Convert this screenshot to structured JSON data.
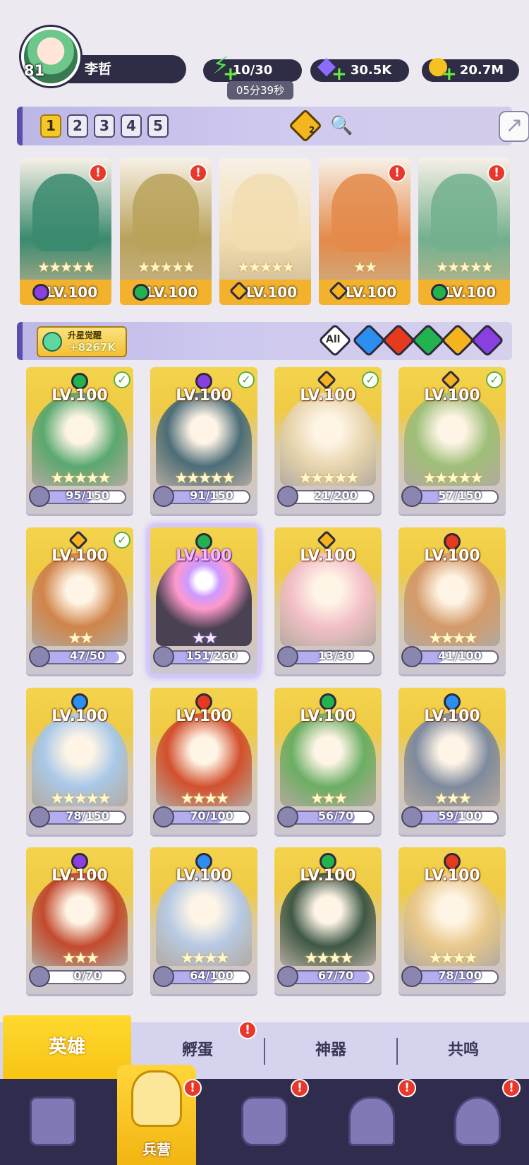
{
  "profile": {
    "level": "81",
    "name": "李哲"
  },
  "resources": {
    "energy": "10/30",
    "energy_timer": "05分39秒",
    "gems": "30.5K",
    "gold": "20.7M"
  },
  "team": {
    "tabs": [
      "1",
      "2",
      "3",
      "4",
      "5"
    ],
    "active_tab": "1",
    "badge_count": "2",
    "members": [
      {
        "element": "dark",
        "level": "LV.100",
        "stars": 5,
        "alert": true,
        "color": "#3a8a6e"
      },
      {
        "element": "wind",
        "level": "LV.100",
        "stars": 5,
        "alert": true,
        "color": "#b9a25a"
      },
      {
        "element": "light",
        "level": "LV.100",
        "stars": 5,
        "alert": false,
        "color": "#f2ddb0"
      },
      {
        "element": "light",
        "level": "LV.100",
        "stars": 2,
        "alert": true,
        "color": "#e48a4a"
      },
      {
        "element": "wind",
        "level": "LV.100",
        "stars": 5,
        "alert": true,
        "color": "#72b08d"
      }
    ]
  },
  "filter": {
    "awaken_label": "升星觉醒",
    "awaken_value": "+8267K",
    "all_label": "All",
    "elements": [
      "water",
      "fire",
      "wind",
      "light",
      "dark"
    ]
  },
  "heroes": [
    {
      "element": "wind",
      "level": "LV.100",
      "stars": 5,
      "check": true,
      "shards": "95/150",
      "progress": 0.63,
      "color": "#5aa870"
    },
    {
      "element": "dark",
      "level": "LV.100",
      "stars": 5,
      "check": true,
      "shards": "91/150",
      "progress": 0.61,
      "color": "#4c6d78"
    },
    {
      "element": "light",
      "level": "LV.100",
      "stars": 5,
      "check": true,
      "shards": "21/200",
      "progress": 0.11,
      "color": "#e8d6b0"
    },
    {
      "element": "light",
      "level": "LV.100",
      "stars": 5,
      "check": true,
      "shards": "57/150",
      "progress": 0.38,
      "color": "#9fbf79"
    },
    {
      "element": "light",
      "level": "LV.100",
      "stars": 2,
      "check": true,
      "shards": "47/50",
      "progress": 0.94,
      "color": "#d0844a"
    },
    {
      "element": "wind",
      "level": "LV.100",
      "stars": 2,
      "check": false,
      "shards": "151/260",
      "progress": 0.58,
      "color": "#4a4252",
      "selected": true,
      "rainbow": true
    },
    {
      "element": "light",
      "level": "LV.100",
      "stars": 0,
      "check": false,
      "shards": "13/30",
      "progress": 0.43,
      "color": "#f3c0c8"
    },
    {
      "element": "fire",
      "level": "LV.100",
      "stars": 4,
      "check": false,
      "shards": "41/100",
      "progress": 0.41,
      "color": "#d49a6a"
    },
    {
      "element": "water",
      "level": "LV.100",
      "stars": 5,
      "check": false,
      "shards": "78/150",
      "progress": 0.52,
      "color": "#a9c8e8"
    },
    {
      "element": "fire",
      "level": "LV.100",
      "stars": 4,
      "check": false,
      "shards": "70/100",
      "progress": 0.7,
      "color": "#d2502e"
    },
    {
      "element": "wind",
      "level": "LV.100",
      "stars": 3,
      "check": false,
      "shards": "56/70",
      "progress": 0.8,
      "color": "#6bae64"
    },
    {
      "element": "water",
      "level": "LV.100",
      "stars": 3,
      "check": false,
      "shards": "59/100",
      "progress": 0.59,
      "color": "#7f8a9e"
    },
    {
      "element": "dark",
      "level": "LV.100",
      "stars": 3,
      "check": false,
      "shards": "0/70",
      "progress": 0.0,
      "color": "#c24a2e"
    },
    {
      "element": "water",
      "level": "LV.100",
      "stars": 4,
      "check": false,
      "shards": "64/100",
      "progress": 0.64,
      "color": "#b7c9e4"
    },
    {
      "element": "wind",
      "level": "LV.100",
      "stars": 4,
      "check": false,
      "shards": "67/70",
      "progress": 0.96,
      "color": "#3f5846"
    },
    {
      "element": "fire",
      "level": "LV.100",
      "stars": 4,
      "check": false,
      "shards": "78/100",
      "progress": 0.78,
      "color": "#e9c98c"
    }
  ],
  "subtabs": {
    "heroes": "英雄",
    "hatch": "孵蛋",
    "artifact": "神器",
    "resonance": "共鸣"
  },
  "bottom_nav": {
    "active_label": "兵营"
  },
  "alert_mark": "!",
  "check_mark": "✓",
  "star_glyph": "★",
  "colors": {
    "accent": "#f5c829",
    "nav_bg": "#302c4e",
    "alert": "#e8372b"
  }
}
